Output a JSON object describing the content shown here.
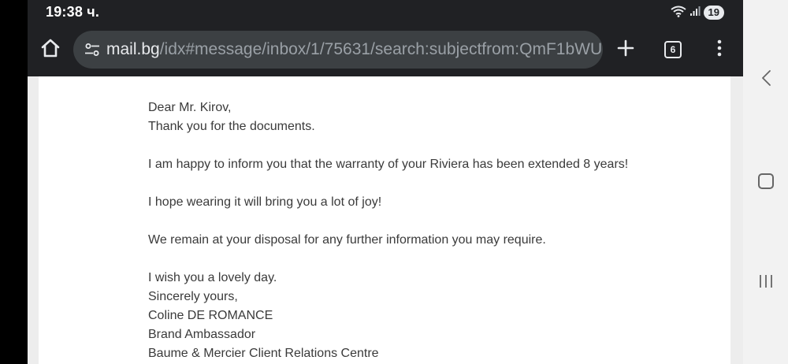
{
  "status_bar": {
    "time": "19:38 ч.",
    "battery": "19"
  },
  "browser": {
    "url_domain": "mail.bg",
    "url_path": "/idx#message/inbox/1/75631/search:subjectfrom:QmF1bWU,",
    "tab_count": "6"
  },
  "email": {
    "salutation": "Dear Mr. Kirov,",
    "thanks": "Thank you for the documents.",
    "p1": "I am happy to inform you that the warranty of your Riviera has been extended 8 years!",
    "p2": "I hope wearing it will bring you a lot of joy!",
    "p3": "We remain at your disposal for any further information you may require.",
    "closing": "I wish you a lovely day.",
    "signoff": "Sincerely yours,",
    "sender_name": "Coline DE ROMANCE",
    "sender_title": "Brand Ambassador",
    "sender_org": "Baume & Mercier Client Relations Centre"
  },
  "icons": {
    "home": "home-icon",
    "site_settings": "tune-icon",
    "new_tab": "plus-icon",
    "tabs": "tab-switcher-icon",
    "menu": "more-vert-icon",
    "back": "back-icon",
    "home_nav": "home-nav-icon",
    "recents": "recents-icon"
  },
  "colors": {
    "browser_bg": "#202124",
    "url_bar_bg": "#3c4043",
    "nav_bar_bg": "#f2f2f2",
    "email_text": "#3a3a3a"
  }
}
